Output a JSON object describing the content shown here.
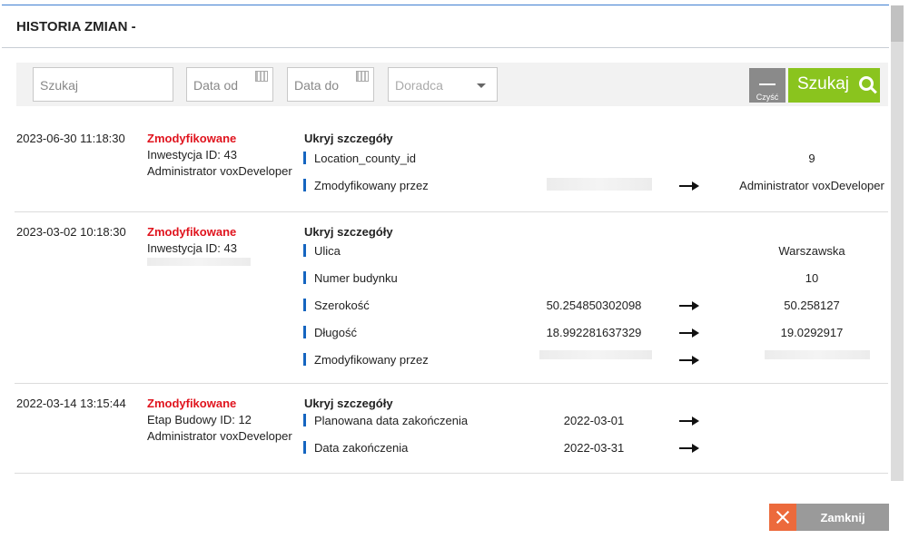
{
  "header": {
    "title": "HISTORIA ZMIAN -"
  },
  "filters": {
    "search_placeholder": "Szukaj",
    "date_from_placeholder": "Data od",
    "date_to_placeholder": "Data do",
    "advisor_placeholder": "Doradca",
    "clear_label": "Czyść",
    "search_label": "Szukaj"
  },
  "entries": [
    {
      "datetime": "2023-06-30 11:18:30",
      "status": "Zmodyfikowane",
      "object": "Inwestycja ID: 43",
      "author": "Administrator voxDeveloper",
      "toggle": "Ukryj szczegóły",
      "changes": [
        {
          "field": "Location_county_id",
          "old": "",
          "new": "9"
        },
        {
          "field": "Zmodyfikowany przez",
          "old": "",
          "new": "Administrator voxDeveloper"
        }
      ]
    },
    {
      "datetime": "2023-03-02 10:18:30",
      "status": "Zmodyfikowane",
      "object": "Inwestycja ID: 43",
      "author": "",
      "toggle": "Ukryj szczegóły",
      "changes": [
        {
          "field": "Ulica",
          "old": "",
          "new": "Warszawska"
        },
        {
          "field": "Numer budynku",
          "old": "",
          "new": "10"
        },
        {
          "field": "Szerokość",
          "old": "50.254850302098",
          "new": "50.258127"
        },
        {
          "field": "Długość",
          "old": "18.992281637329",
          "new": "19.0292917"
        },
        {
          "field": "Zmodyfikowany przez",
          "old": "",
          "new": ""
        }
      ]
    },
    {
      "datetime": "2022-03-14 13:15:44",
      "status": "Zmodyfikowane",
      "object": "Etap Budowy ID: 12",
      "author": "Administrator voxDeveloper",
      "toggle": "Ukryj szczegóły",
      "changes": [
        {
          "field": "Planowana data zakończenia",
          "old": "2022-03-01",
          "new": ""
        },
        {
          "field": "Data zakończenia",
          "old": "2022-03-31",
          "new": ""
        }
      ]
    }
  ],
  "footer": {
    "close_label": "Zamknij"
  },
  "colors": {
    "accent": "#3f7fd0",
    "status": "#e0141e",
    "search": "#8ac41e",
    "close_icon": "#ec6a3c"
  }
}
